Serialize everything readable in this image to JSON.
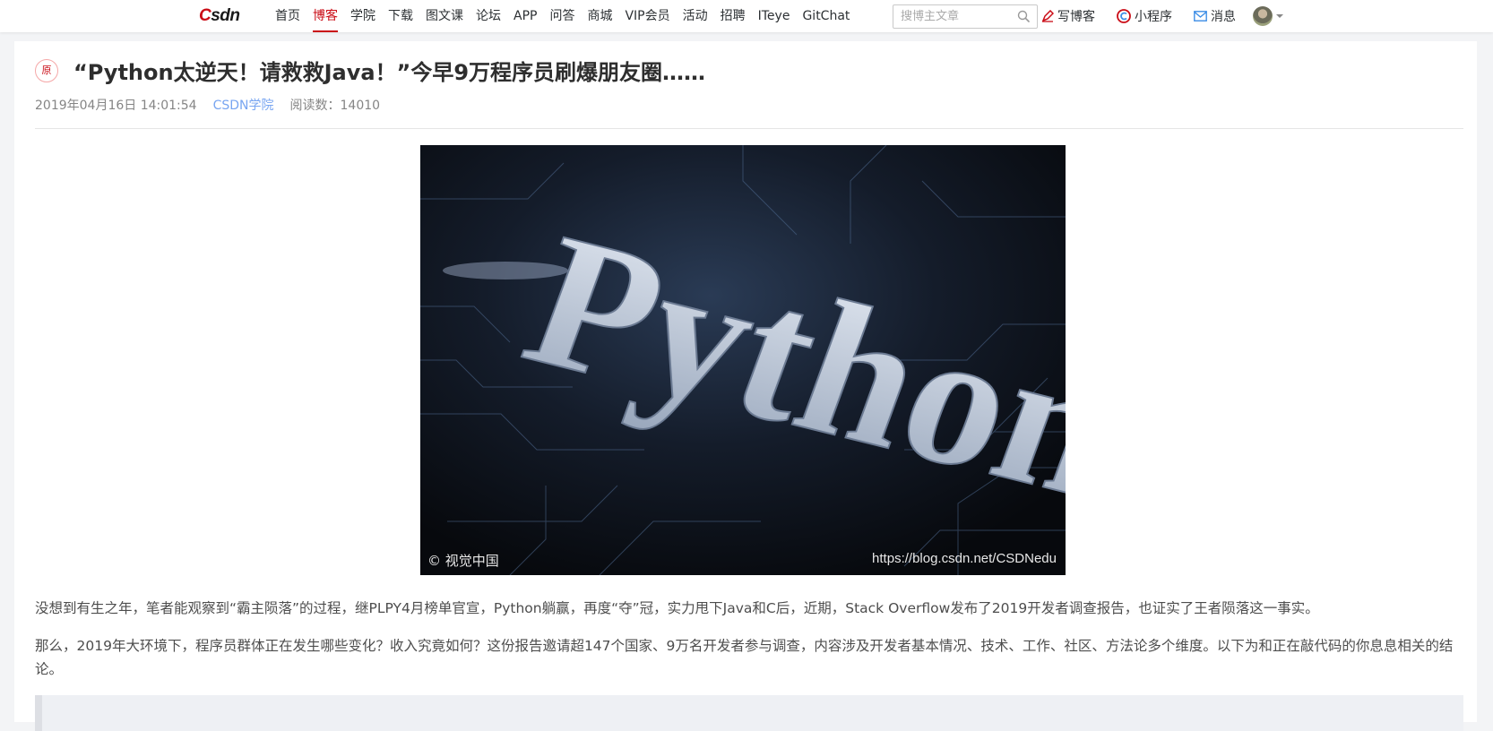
{
  "header": {
    "logo_text": "CSDN",
    "nav": [
      {
        "label": "首页",
        "active": false
      },
      {
        "label": "博客",
        "active": true
      },
      {
        "label": "学院",
        "active": false
      },
      {
        "label": "下载",
        "active": false
      },
      {
        "label": "图文课",
        "active": false
      },
      {
        "label": "论坛",
        "active": false
      },
      {
        "label": "APP",
        "active": false
      },
      {
        "label": "问答",
        "active": false
      },
      {
        "label": "商城",
        "active": false
      },
      {
        "label": "VIP会员",
        "active": false
      },
      {
        "label": "活动",
        "active": false
      },
      {
        "label": "招聘",
        "active": false
      },
      {
        "label": "ITeye",
        "active": false
      },
      {
        "label": "GitChat",
        "active": false
      }
    ],
    "search": {
      "placeholder": "搜博主文章",
      "value": ""
    },
    "write_blog": "写博客",
    "mini_program": "小程序",
    "messages": "消息"
  },
  "article": {
    "badge": "原",
    "title": "“Python太逆天！请救救Java！”今早9万程序员刷爆朋友圈……",
    "datetime": "2019年04月16日 14:01:54",
    "source": "CSDN学院",
    "reads": "阅读数：14010",
    "image": {
      "word": "Python",
      "watermark_left": "© 视觉中国",
      "watermark_right": "https://blog.csdn.net/CSDNedu"
    },
    "paragraphs": [
      "没想到有生之年，笔者能观察到“霸主陨落”的过程，继PLPY4月榜单官宣，Python躺赢，再度“夺”冠，实力甩下Java和C后，近期，Stack Overflow发布了2019开发者调查报告，也证实了王者陨落这一事实。",
      "那么，2019年大环境下，程序员群体正在发生哪些变化？收入究竟如何？这份报告邀请超147个国家、9万名开发者参与调查，内容涉及开发者基本情况、技术、工作、社区、方法论多个维度。以下为和正在敲代码的你息息相关的结论。"
    ]
  },
  "colors": {
    "brand_red": "#ca0c16",
    "link_blue": "#78a5f1",
    "message_blue": "#3d8ee6"
  }
}
